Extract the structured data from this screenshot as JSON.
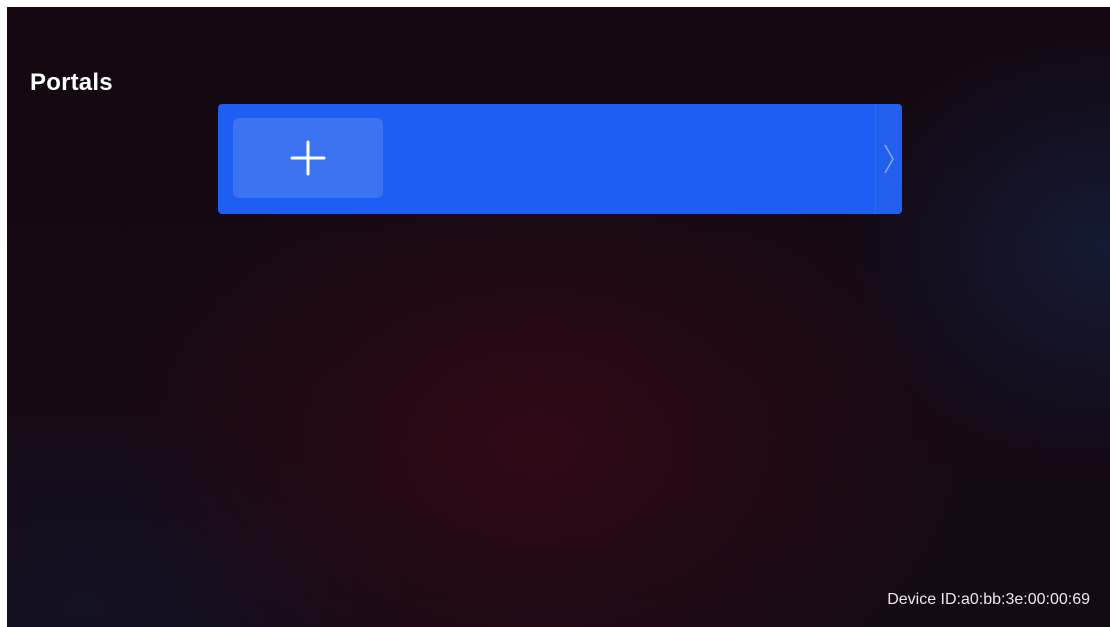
{
  "page": {
    "title": "Portals"
  },
  "portals": {
    "add_tile": {
      "icon": "plus-icon"
    },
    "scroll": {
      "icon": "chevron-right-icon"
    }
  },
  "footer": {
    "device_id": "Device ID:a0:bb:3e:00:00:69"
  },
  "colors": {
    "row_background": "#1f5ef2",
    "add_tile_background": "#3b73f0",
    "screen_background": "#140914",
    "text": "#ffffff"
  }
}
